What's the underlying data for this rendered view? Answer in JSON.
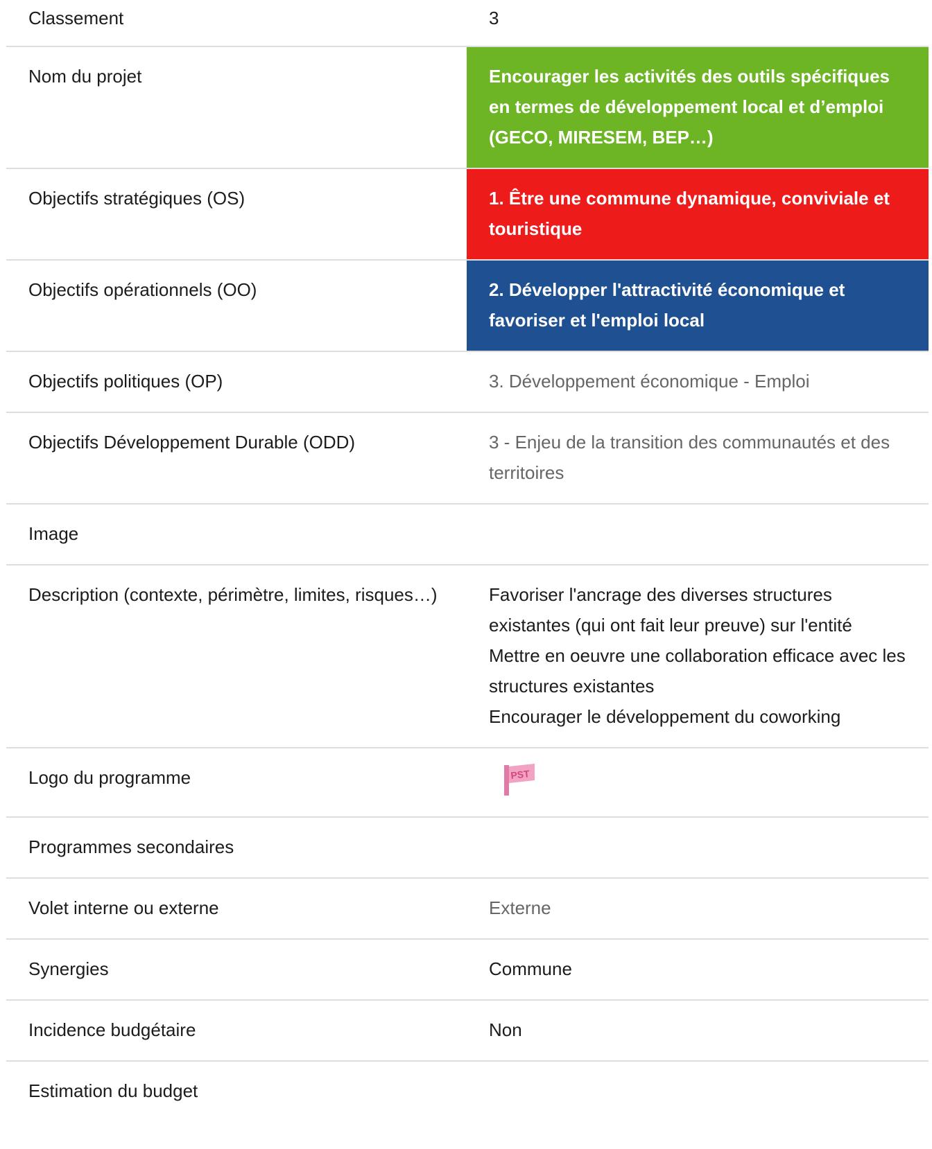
{
  "rows": [
    {
      "label": "Classement",
      "value": "3"
    },
    {
      "label": "Nom du projet",
      "value": "Encourager les activités des outils spécifiques en termes de développement local et d’emploi (GECO, MIRESEM, BEP…)"
    },
    {
      "label": "Objectifs stratégiques (OS)",
      "value": "1. Être une commune dynamique, conviviale et touristique"
    },
    {
      "label": "Objectifs opérationnels (OO)",
      "value": "2. Développer l'attractivité économique et favoriser et l'emploi local"
    },
    {
      "label": "Objectifs politiques (OP)",
      "value": "3. Développement économique - Emploi"
    },
    {
      "label": "Objectifs Développement Durable (ODD)",
      "value": "3 - Enjeu de la transition des communautés et des territoires"
    },
    {
      "label": "Image",
      "value": ""
    },
    {
      "label": "Description (contexte, périmètre, limites, risques…)",
      "value_lines": [
        "Favoriser l'ancrage des diverses structures existantes (qui ont fait leur preuve) sur l'entité",
        "Mettre en oeuvre une collaboration efficace avec les structures existantes",
        "Encourager le développement du coworking"
      ]
    },
    {
      "label": "Logo du programme",
      "logo_text": "PST"
    },
    {
      "label": "Programmes secondaires",
      "value": ""
    },
    {
      "label": "Volet interne ou externe",
      "value": "Externe"
    },
    {
      "label": "Synergies",
      "value": "Commune"
    },
    {
      "label": "Incidence budgétaire",
      "value": "Non"
    },
    {
      "label": "Estimation du budget",
      "value": ""
    }
  ],
  "colors": {
    "project_name_bg": "#6db524",
    "strategic_bg": "#ee1b1b",
    "operational_bg": "#1f5192",
    "logo_flag": "#f2a3c3",
    "logo_pole": "#e07aa6",
    "logo_text": "#d4477e"
  },
  "icons": {
    "logo": "pst-flag-logo"
  }
}
